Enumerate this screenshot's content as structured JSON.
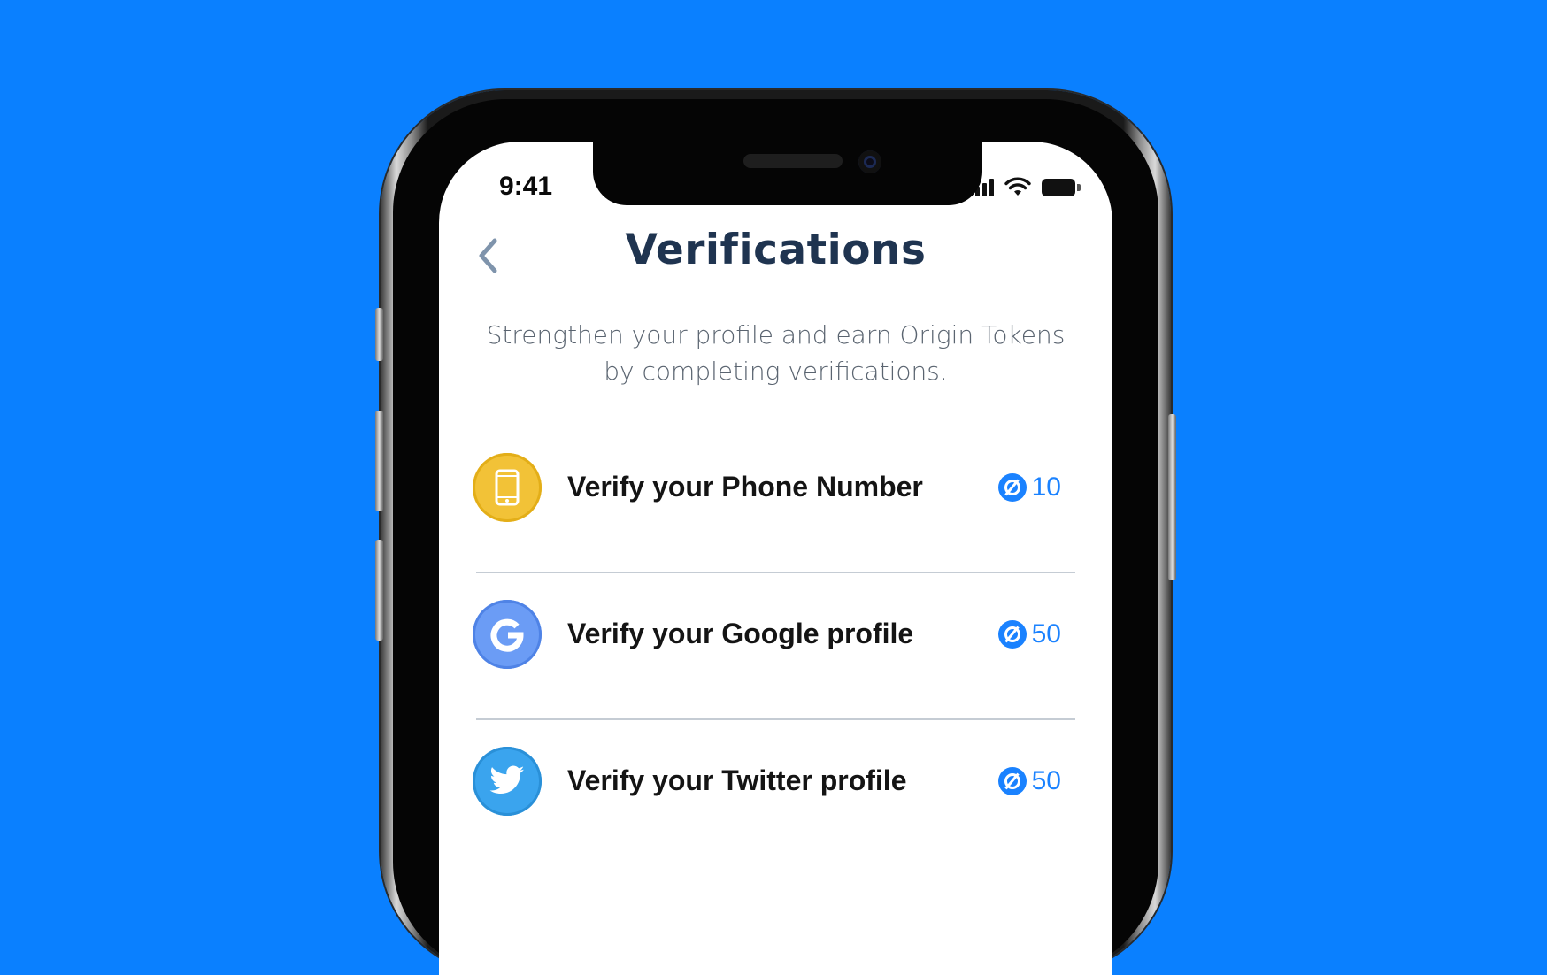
{
  "status_bar": {
    "time": "9:41"
  },
  "header": {
    "title": "Verifications",
    "back_icon": "chevron-left-icon"
  },
  "intro": {
    "text": "Strengthen your profile and earn Origin Tokens by completing verifications."
  },
  "verifications": [
    {
      "label": "Verify your Phone Number",
      "icon": "phone-icon",
      "color": "#f2c237",
      "border": "#e3ae18",
      "reward": "10"
    },
    {
      "label": "Verify your Google profile",
      "icon": "google-icon",
      "color": "#6b9cf5",
      "border": "#4f83e6",
      "reward": "50"
    },
    {
      "label": "Verify your Twitter profile",
      "icon": "twitter-icon",
      "color": "#3aa4ee",
      "border": "#2a90d8",
      "reward": "50"
    }
  ],
  "colors": {
    "background": "#0a80ff",
    "accent": "#1a82ff",
    "title": "#1f3450"
  }
}
